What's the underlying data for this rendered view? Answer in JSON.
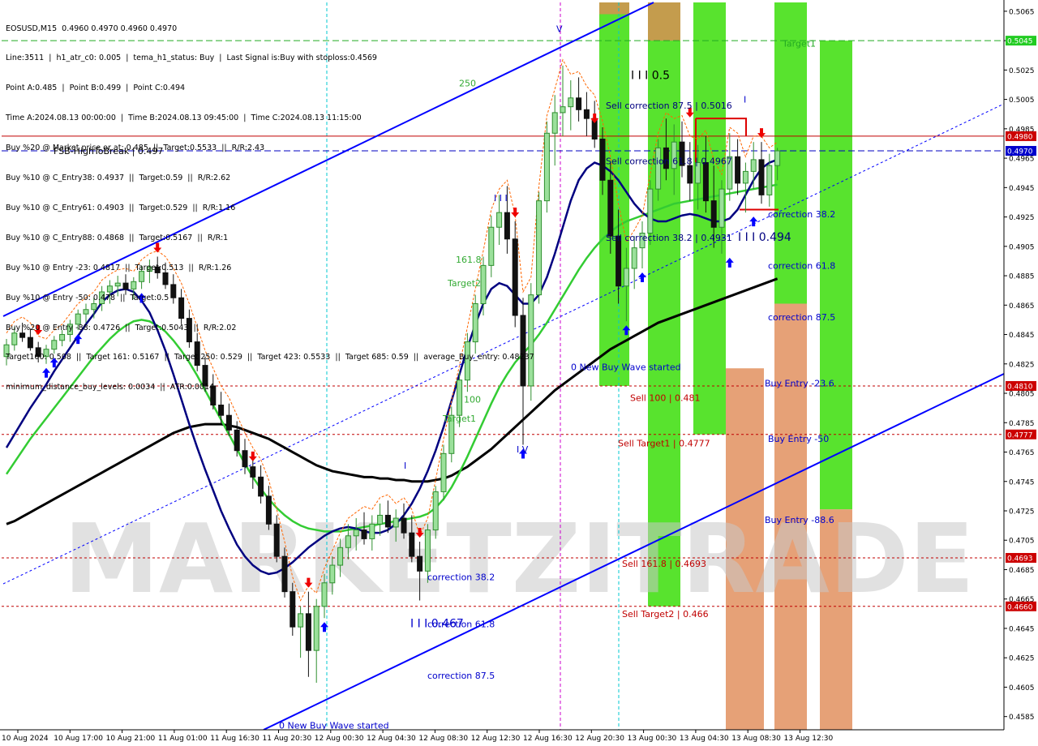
{
  "header": {
    "lines": [
      "EOSUSD,M15  0.4960 0.4970 0.4960 0.4970",
      "Line:3511  |  h1_atr_c0: 0.005  |  tema_h1_status: Buy  |  Last Signal is:Buy with stoploss:0.4569",
      "Point A:0.485  |  Point B:0.499  |  Point C:0.494",
      "Time A:2024.08.13 00:00:00  |  Time B:2024.08.13 09:45:00  |  Time C:2024.08.13 11:15:00",
      "Buy %20 @ Market price or at: 0.485  ||  Target:0.5533  ||  R/R:2.43",
      "Buy %10 @ C_Entry38: 0.4937  ||  Target:0.59  ||  R/R:2.62",
      "Buy %10 @ C_Entry61: 0.4903  ||  Target:0.529  ||  R/R:1.16",
      "Buy %10 @ C_Entry88: 0.4868  ||  Target:0.5167  ||  R/R:1",
      "Buy %10 @ Entry -23: 0.4817  ||  Target:0.513  ||  R/R:1.26",
      "Buy %10 @ Entry -50: 0.478  ||  Target:0.5",
      "Buy %20 @ Entry -88: 0.4726  ||  Target:0.5043  ||  R/R:2.02",
      "Target100: 0.508  ||  Target 161: 0.5167  ||  Target 250: 0.529  ||  Target 423: 0.5533  ||  Target 685: 0.59  ||  average_Buy_entry: 0.48237",
      "minimum_distance_buy_levels: 0.0034  ||  ATR:0.0014"
    ]
  },
  "colors": {
    "bull": "#2f8f2f",
    "bear": "#111111",
    "green_zone": "#33dd00",
    "orange_zone": "#e08a55",
    "channel": "#0000ff",
    "ma_navy": "#000080",
    "ma_green": "#33cc33",
    "ma_black": "#000000",
    "hline_red": "#c00000",
    "hline_blue": "#0000c0",
    "cyan_v": "#00c8d2",
    "magenta_v": "#cc00cc"
  },
  "chart_data": {
    "type": "candlestick",
    "symbol": "EOSUSD,M15",
    "ylim": [
      0.4576,
      0.5071
    ],
    "y_ticks": [
      "0.5065",
      "0.5045",
      "0.5025",
      "0.5005",
      "0.4985",
      "0.4965",
      "0.4945",
      "0.4925",
      "0.4905",
      "0.4885",
      "0.4865",
      "0.4845",
      "0.4825",
      "0.4805",
      "0.4785",
      "0.4765",
      "0.4745",
      "0.4725",
      "0.4705",
      "0.4685",
      "0.4665",
      "0.4645",
      "0.4625",
      "0.4605",
      "0.4585"
    ],
    "x_labels": [
      "10 Aug 2024",
      "10 Aug 17:00",
      "10 Aug 21:00",
      "11 Aug 01:00",
      "11 Aug 16:30",
      "11 Aug 20:30",
      "12 Aug 00:30",
      "12 Aug 04:30",
      "12 Aug 08:30",
      "12 Aug 12:30",
      "12 Aug 16:30",
      "12 Aug 20:30",
      "13 Aug 00:30",
      "13 Aug 04:30",
      "13 Aug 08:30",
      "13 Aug 12:30"
    ],
    "price_tags": [
      {
        "value": 0.5045,
        "label": "0.5045",
        "bg": "#22cc22"
      },
      {
        "value": 0.498,
        "label": "0.4980",
        "bg": "#cc0000"
      },
      {
        "value": 0.497,
        "label": "0.4970",
        "bg": "#0000cc"
      },
      {
        "value": 0.481,
        "label": "0.4810",
        "bg": "#cc0000"
      },
      {
        "value": 0.4777,
        "label": "0.4777",
        "bg": "#cc0000"
      },
      {
        "value": 0.4693,
        "label": "0.4693",
        "bg": "#cc0000"
      },
      {
        "value": 0.466,
        "label": "0.4660",
        "bg": "#cc0000"
      }
    ],
    "candles": [
      [
        0.483,
        0.4842,
        0.4824,
        0.4838
      ],
      [
        0.4838,
        0.485,
        0.4834,
        0.4846
      ],
      [
        0.4846,
        0.4853,
        0.484,
        0.4843
      ],
      [
        0.4843,
        0.4849,
        0.4834,
        0.4836
      ],
      [
        0.4836,
        0.484,
        0.4826,
        0.483
      ],
      [
        0.483,
        0.4838,
        0.4825,
        0.4835
      ],
      [
        0.4835,
        0.4844,
        0.4832,
        0.4841
      ],
      [
        0.4841,
        0.4848,
        0.4837,
        0.4845
      ],
      [
        0.4845,
        0.4855,
        0.484,
        0.4852
      ],
      [
        0.4852,
        0.4862,
        0.4848,
        0.4859
      ],
      [
        0.4859,
        0.4866,
        0.4853,
        0.4862
      ],
      [
        0.4862,
        0.487,
        0.4856,
        0.4866
      ],
      [
        0.4866,
        0.4878,
        0.4861,
        0.4874
      ],
      [
        0.4874,
        0.4882,
        0.4866,
        0.4878
      ],
      [
        0.4878,
        0.4885,
        0.4871,
        0.488
      ],
      [
        0.488,
        0.4886,
        0.4872,
        0.4876
      ],
      [
        0.4876,
        0.4884,
        0.4869,
        0.4881
      ],
      [
        0.4881,
        0.4892,
        0.4876,
        0.4888
      ],
      [
        0.4888,
        0.4896,
        0.488,
        0.4891
      ],
      [
        0.4891,
        0.4898,
        0.4883,
        0.4887
      ],
      [
        0.4887,
        0.4894,
        0.4876,
        0.4879
      ],
      [
        0.4879,
        0.4886,
        0.4866,
        0.487
      ],
      [
        0.487,
        0.4876,
        0.4852,
        0.4856
      ],
      [
        0.4856,
        0.4862,
        0.4836,
        0.484
      ],
      [
        0.484,
        0.4846,
        0.482,
        0.4824
      ],
      [
        0.4824,
        0.483,
        0.4806,
        0.481
      ],
      [
        0.481,
        0.4818,
        0.4794,
        0.4797
      ],
      [
        0.4797,
        0.4806,
        0.4784,
        0.479
      ],
      [
        0.479,
        0.4798,
        0.4776,
        0.478
      ],
      [
        0.478,
        0.4786,
        0.4762,
        0.4766
      ],
      [
        0.4766,
        0.4774,
        0.475,
        0.4755
      ],
      [
        0.4755,
        0.4764,
        0.474,
        0.4748
      ],
      [
        0.4748,
        0.4756,
        0.473,
        0.4735
      ],
      [
        0.4735,
        0.4742,
        0.4712,
        0.4716
      ],
      [
        0.4716,
        0.4722,
        0.469,
        0.4694
      ],
      [
        0.4694,
        0.47,
        0.4666,
        0.467
      ],
      [
        0.467,
        0.4676,
        0.464,
        0.4646
      ],
      [
        0.4646,
        0.466,
        0.4625,
        0.4655
      ],
      [
        0.4655,
        0.467,
        0.4612,
        0.463
      ],
      [
        0.463,
        0.4665,
        0.4608,
        0.466
      ],
      [
        0.466,
        0.4682,
        0.4652,
        0.4676
      ],
      [
        0.4676,
        0.4694,
        0.4668,
        0.4688
      ],
      [
        0.4688,
        0.4706,
        0.468,
        0.47
      ],
      [
        0.47,
        0.4716,
        0.4692,
        0.4708
      ],
      [
        0.4708,
        0.472,
        0.4698,
        0.4712
      ],
      [
        0.4712,
        0.4724,
        0.4702,
        0.4706
      ],
      [
        0.4706,
        0.4722,
        0.4698,
        0.4716
      ],
      [
        0.4716,
        0.473,
        0.4708,
        0.4722
      ],
      [
        0.4722,
        0.4732,
        0.471,
        0.4714
      ],
      [
        0.4714,
        0.4726,
        0.4704,
        0.472
      ],
      [
        0.472,
        0.473,
        0.4706,
        0.471
      ],
      [
        0.471,
        0.4722,
        0.469,
        0.4694
      ],
      [
        0.4694,
        0.4704,
        0.4664,
        0.4684
      ],
      [
        0.4684,
        0.4716,
        0.4676,
        0.4712
      ],
      [
        0.4712,
        0.4742,
        0.4706,
        0.4738
      ],
      [
        0.4738,
        0.477,
        0.4732,
        0.4764
      ],
      [
        0.4764,
        0.4796,
        0.4758,
        0.479
      ],
      [
        0.479,
        0.482,
        0.4782,
        0.4814
      ],
      [
        0.4814,
        0.4846,
        0.4806,
        0.484
      ],
      [
        0.484,
        0.4872,
        0.4832,
        0.4866
      ],
      [
        0.4866,
        0.4898,
        0.4858,
        0.4892
      ],
      [
        0.4892,
        0.4926,
        0.4884,
        0.4918
      ],
      [
        0.4918,
        0.494,
        0.4906,
        0.4928
      ],
      [
        0.4928,
        0.4946,
        0.49,
        0.491
      ],
      [
        0.491,
        0.4922,
        0.485,
        0.4858
      ],
      [
        0.4858,
        0.487,
        0.477,
        0.481
      ],
      [
        0.481,
        0.488,
        0.48,
        0.4872
      ],
      [
        0.4872,
        0.4942,
        0.4866,
        0.4936
      ],
      [
        0.4936,
        0.499,
        0.4928,
        0.4982
      ],
      [
        0.4982,
        0.5008,
        0.496,
        0.4996
      ],
      [
        0.4996,
        0.5028,
        0.498,
        0.5
      ],
      [
        0.5,
        0.5018,
        0.4984,
        0.5006
      ],
      [
        0.5006,
        0.502,
        0.499,
        0.4998
      ],
      [
        0.4998,
        0.501,
        0.498,
        0.4992
      ],
      [
        0.4992,
        0.5004,
        0.4972,
        0.4978
      ],
      [
        0.4978,
        0.4986,
        0.494,
        0.495
      ],
      [
        0.495,
        0.4962,
        0.49,
        0.4912
      ],
      [
        0.4912,
        0.493,
        0.4866,
        0.4878
      ],
      [
        0.4878,
        0.4904,
        0.4854,
        0.489
      ],
      [
        0.489,
        0.4912,
        0.4876,
        0.4904
      ],
      [
        0.4904,
        0.4922,
        0.489,
        0.4914
      ],
      [
        0.4914,
        0.495,
        0.4906,
        0.4944
      ],
      [
        0.4944,
        0.4978,
        0.4936,
        0.4972
      ],
      [
        0.4972,
        0.4992,
        0.495,
        0.4958
      ],
      [
        0.4958,
        0.4988,
        0.494,
        0.4976
      ],
      [
        0.4976,
        0.499,
        0.4952,
        0.496
      ],
      [
        0.496,
        0.4976,
        0.4936,
        0.4948
      ],
      [
        0.4948,
        0.4974,
        0.493,
        0.4962
      ],
      [
        0.4962,
        0.498,
        0.4928,
        0.4936
      ],
      [
        0.4936,
        0.496,
        0.4904,
        0.4918
      ],
      [
        0.4918,
        0.495,
        0.49,
        0.4944
      ],
      [
        0.4944,
        0.4982,
        0.4936,
        0.4966
      ],
      [
        0.4966,
        0.4978,
        0.494,
        0.4948
      ],
      [
        0.4948,
        0.4962,
        0.4928,
        0.4956
      ],
      [
        0.4956,
        0.4976,
        0.4944,
        0.4964
      ],
      [
        0.4964,
        0.4976,
        0.4934,
        0.494
      ],
      [
        0.494,
        0.4968,
        0.4932,
        0.496
      ],
      [
        0.496,
        0.4972,
        0.495,
        0.497
      ]
    ],
    "ma_navy": [
      0.4768,
      0.4777,
      0.4786,
      0.4795,
      0.4803,
      0.4811,
      0.482,
      0.4828,
      0.4836,
      0.4844,
      0.4852,
      0.4859,
      0.4867,
      0.4872,
      0.4875,
      0.4876,
      0.4874,
      0.4868,
      0.486,
      0.4848,
      0.4834,
      0.4818,
      0.4801,
      0.4784,
      0.4768,
      0.4753,
      0.4739,
      0.4725,
      0.4713,
      0.4702,
      0.4694,
      0.4688,
      0.4684,
      0.4682,
      0.4683,
      0.4686,
      0.469,
      0.4695,
      0.47,
      0.4704,
      0.4708,
      0.4711,
      0.4713,
      0.4714,
      0.4713,
      0.4711,
      0.471,
      0.471,
      0.4712,
      0.4716,
      0.4722,
      0.473,
      0.474,
      0.4752,
      0.4766,
      0.4782,
      0.48,
      0.4818,
      0.4836,
      0.4852,
      0.4866,
      0.4876,
      0.488,
      0.4878,
      0.4872,
      0.4866,
      0.4866,
      0.4872,
      0.4884,
      0.49,
      0.4918,
      0.4936,
      0.495,
      0.4958,
      0.4962,
      0.496,
      0.4956,
      0.495,
      0.4942,
      0.4934,
      0.4928,
      0.4924,
      0.4922,
      0.4922,
      0.4924,
      0.4926,
      0.4927,
      0.4926,
      0.4924,
      0.4922,
      0.4922,
      0.4924,
      0.493,
      0.494,
      0.495,
      0.4958,
      0.4962,
      0.4964
    ],
    "ma_green": [
      0.475,
      0.4758,
      0.4766,
      0.4774,
      0.4781,
      0.4788,
      0.4795,
      0.4802,
      0.4809,
      0.4816,
      0.4823,
      0.483,
      0.4836,
      0.4842,
      0.4847,
      0.4851,
      0.4854,
      0.4855,
      0.4854,
      0.4851,
      0.4847,
      0.4841,
      0.4834,
      0.4826,
      0.4817,
      0.4807,
      0.4797,
      0.4787,
      0.4777,
      0.4767,
      0.4757,
      0.4748,
      0.474,
      0.4733,
      0.4727,
      0.4722,
      0.4718,
      0.4715,
      0.4713,
      0.4712,
      0.4711,
      0.4711,
      0.4711,
      0.4712,
      0.4713,
      0.4714,
      0.4715,
      0.4716,
      0.4717,
      0.4718,
      0.4719,
      0.472,
      0.4721,
      0.4723,
      0.4727,
      0.4733,
      0.4741,
      0.4751,
      0.4762,
      0.4774,
      0.4786,
      0.4798,
      0.4809,
      0.4818,
      0.4826,
      0.4832,
      0.4838,
      0.4845,
      0.4853,
      0.4862,
      0.4871,
      0.488,
      0.4889,
      0.4897,
      0.4904,
      0.491,
      0.4915,
      0.4919,
      0.4922,
      0.4924,
      0.4926,
      0.4928,
      0.493,
      0.4932,
      0.4934,
      0.4935,
      0.4936,
      0.4937,
      0.4938,
      0.4939,
      0.494,
      0.4941,
      0.4942,
      0.4943,
      0.4944,
      0.4945,
      0.4946,
      0.4947
    ],
    "ma_black": [
      0.4716,
      0.4718,
      0.4721,
      0.4724,
      0.4727,
      0.473,
      0.4733,
      0.4736,
      0.4739,
      0.4742,
      0.4745,
      0.4748,
      0.4751,
      0.4754,
      0.4757,
      0.476,
      0.4763,
      0.4766,
      0.4769,
      0.4772,
      0.4775,
      0.4778,
      0.478,
      0.4782,
      0.4783,
      0.4784,
      0.4784,
      0.4784,
      0.4783,
      0.4782,
      0.478,
      0.4778,
      0.4776,
      0.4774,
      0.4771,
      0.4768,
      0.4765,
      0.4762,
      0.4759,
      0.4756,
      0.4754,
      0.4752,
      0.4751,
      0.475,
      0.4749,
      0.4748,
      0.4748,
      0.4747,
      0.4747,
      0.4746,
      0.4746,
      0.4745,
      0.4745,
      0.4745,
      0.4746,
      0.4747,
      0.4749,
      0.4752,
      0.4755,
      0.4759,
      0.4763,
      0.4767,
      0.4772,
      0.4777,
      0.4782,
      0.4787,
      0.4792,
      0.4797,
      0.4802,
      0.4807,
      0.4811,
      0.4815,
      0.4819,
      0.4823,
      0.4827,
      0.4831,
      0.4835,
      0.4838,
      0.4841,
      0.4844,
      0.4847,
      0.485,
      0.4853,
      0.4855,
      0.4857,
      0.4859,
      0.4861,
      0.4863,
      0.4865,
      0.4867,
      0.4869,
      0.4871,
      0.4873,
      0.4875,
      0.4877,
      0.4879,
      0.4881,
      0.4883
    ],
    "h_lines": [
      {
        "value": 0.498,
        "color": "#c00000",
        "style": "solid"
      },
      {
        "value": 0.497,
        "color": "#0000c0",
        "style": "dashed"
      },
      {
        "value": 0.5045,
        "color": "#22aa22",
        "style": "dashed"
      },
      {
        "value": 0.481,
        "color": "#c00000",
        "style": "dotted"
      },
      {
        "value": 0.4777,
        "color": "#c00000",
        "style": "dotted"
      },
      {
        "value": 0.4693,
        "color": "#c00000",
        "style": "dotted"
      },
      {
        "value": 0.466,
        "color": "#c00000",
        "style": "dotted"
      }
    ],
    "labels": [
      {
        "text": "FSB-HighToBreak  |  0.497",
        "value": 0.497,
        "color": "#000000"
      },
      {
        "text": "Target1",
        "value": 0.5043,
        "color": "#22aa22"
      },
      {
        "text": "I I I 0.5",
        "value": 0.5021,
        "color": "#000000"
      },
      {
        "text": "Sell correction 87.5 | 0.5016",
        "value": 0.5001,
        "color": "#000080"
      },
      {
        "text": "Sell correction 61.8 | 0.4967",
        "value": 0.4963,
        "color": "#000080"
      },
      {
        "text": "Sell correction 38.2 | 0.4931",
        "value": 0.4911,
        "color": "#000080"
      },
      {
        "text": "I I I 0.494",
        "value": 0.4911,
        "color": "#000080"
      },
      {
        "text": "correction 38.2",
        "value": 0.4927,
        "color": "#0000cc"
      },
      {
        "text": "correction 61.8",
        "value": 0.4892,
        "color": "#0000cc"
      },
      {
        "text": "correction 87.5",
        "value": 0.4857,
        "color": "#0000cc"
      },
      {
        "text": "0 New Buy Wave started",
        "value": 0.4823,
        "color": "#0000cc"
      },
      {
        "text": "Sell 100 | 0.481",
        "value": 0.4802,
        "color": "#c00000"
      },
      {
        "text": "Buy Entry -23.6",
        "value": 0.4812,
        "color": "#0000cc"
      },
      {
        "text": "Sell Target1 | 0.4777",
        "value": 0.4771,
        "color": "#c00000"
      },
      {
        "text": "Buy Entry -50",
        "value": 0.4774,
        "color": "#0000cc"
      },
      {
        "text": "Buy Entry -88.6",
        "value": 0.4719,
        "color": "#0000cc"
      },
      {
        "text": "Sell 161.8 | 0.4693",
        "value": 0.4689,
        "color": "#c00000"
      },
      {
        "text": "Sell Target2 | 0.466",
        "value": 0.4655,
        "color": "#c00000"
      },
      {
        "text": "correction 38.2",
        "value": 0.468,
        "color": "#0000cc"
      },
      {
        "text": "I I I 0.467",
        "value": 0.4648,
        "color": "#0000cc"
      },
      {
        "text": "correction 61.8",
        "value": 0.4648,
        "color": "#0000cc"
      },
      {
        "text": "correction 87.5",
        "value": 0.4613,
        "color": "#0000cc"
      },
      {
        "text": "0 New Buy Wave started",
        "value": 0.4579,
        "color": "#0000cc"
      },
      {
        "text": "250",
        "value": 0.5016,
        "color": "#33aa33"
      },
      {
        "text": "161.8",
        "value": 0.4896,
        "color": "#33aa33"
      },
      {
        "text": "Target2",
        "value": 0.488,
        "color": "#33aa33"
      },
      {
        "text": "100",
        "value": 0.4801,
        "color": "#33aa33"
      },
      {
        "text": "Target1",
        "value": 0.4788,
        "color": "#33aa33"
      },
      {
        "text": "I I I",
        "value": 0.4938,
        "color": "#0000cc"
      },
      {
        "text": "I",
        "value": 0.4756,
        "color": "#0000cc"
      },
      {
        "text": "V",
        "value": 0.5053,
        "color": "#0000cc"
      },
      {
        "text": "I V",
        "value": 0.4767,
        "color": "#0000cc"
      },
      {
        "text": "I",
        "value": 0.5005,
        "color": "#0000cc"
      }
    ]
  },
  "watermark": "MARKETZITRADE"
}
